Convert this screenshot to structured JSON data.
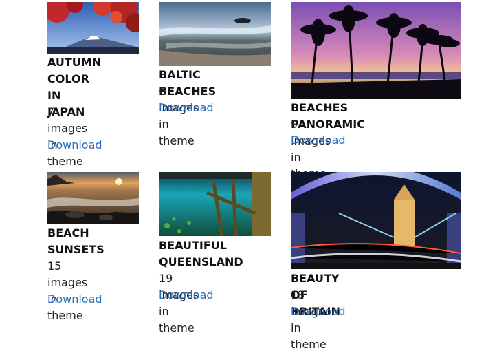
{
  "themes": [
    {
      "title": "AUTUMN COLOR IN JAPAN",
      "title_lines": [
        "AUTUMN",
        "COLOR IN",
        "JAPAN"
      ],
      "count_lines": [
        "7 images in",
        "theme"
      ],
      "download": "Download"
    },
    {
      "title": "BALTIC BEACHES",
      "title_lines": [
        "BALTIC BEACHES"
      ],
      "count_lines": [
        "6 images in theme"
      ],
      "download": "Download"
    },
    {
      "title": "BEACHES PANORAMIC",
      "title_lines": [
        "BEACHES PANORAMIC"
      ],
      "count_lines": [
        "9 images in theme"
      ],
      "download": "Download"
    },
    {
      "title": "BEACH SUNSETS",
      "title_lines": [
        "BEACH",
        "SUNSETS"
      ],
      "count_lines": [
        "15 images in",
        "theme"
      ],
      "download": "Download"
    },
    {
      "title": "BEAUTIFUL QUEENSLAND",
      "title_lines": [
        "BEAUTIFUL",
        "QUEENSLAND"
      ],
      "count_lines": [
        "19 images in theme"
      ],
      "download": "Download"
    },
    {
      "title": "BEAUTY OF BRITAIN",
      "title_lines": [
        "BEAUTY OF BRITAIN"
      ],
      "count_lines": [
        "13 images in theme"
      ],
      "download": "Download"
    }
  ],
  "colors": {
    "link": "#2a6ebb",
    "title": "#111111",
    "text": "#222222",
    "divider": "#d8d8d8"
  }
}
